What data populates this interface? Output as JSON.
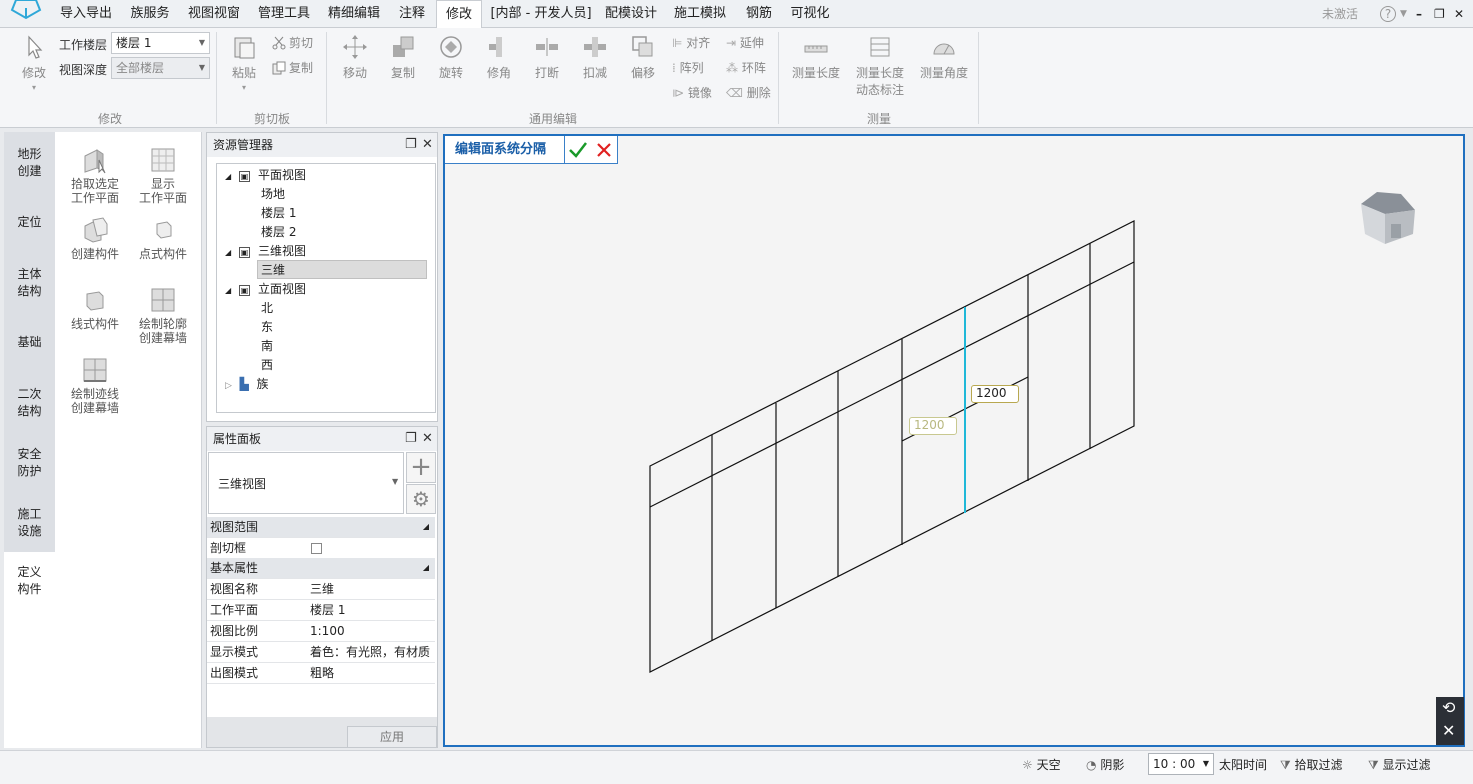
{
  "menu": {
    "items": [
      "导入导出",
      "族服务",
      "视图视窗",
      "管理工具",
      "精细编辑",
      "注释",
      "修改",
      "[内部 - 开发人员]",
      "配模设计",
      "施工模拟",
      "钢筋",
      "可视化"
    ],
    "active": "修改",
    "status_text": "未激活",
    "help": "?"
  },
  "ribbon": {
    "modify": {
      "select_label": "修改",
      "work_floor_label": "工作楼层",
      "work_floor_value": "楼层 1",
      "view_depth_label": "视图深度",
      "view_depth_value": "全部楼层",
      "group": "修改"
    },
    "clipboard": {
      "paste": "粘贴",
      "cut": "剪切",
      "copy": "复制",
      "group": "剪切板"
    },
    "edit": {
      "move": "移动",
      "copy": "复制",
      "rotate": "旋转",
      "trim": "修角",
      "break": "打断",
      "subtract": "扣减",
      "offset": "偏移",
      "align": "对齐",
      "extend": "延伸",
      "array": "阵列",
      "ring_array": "环阵",
      "mirror": "镜像",
      "delete": "删除",
      "group": "通用编辑"
    },
    "measure": {
      "length": "测量长度",
      "dyn_line1": "测量长度",
      "dyn_line2": "动态标注",
      "angle": "测量角度",
      "group": "测量"
    }
  },
  "left_tabs": [
    [
      "地形",
      "创建"
    ],
    [
      "定位",
      ""
    ],
    [
      "主体",
      "结构"
    ],
    [
      "基础",
      ""
    ],
    [
      "二次",
      "结构"
    ],
    [
      "安全",
      "防护"
    ],
    [
      "施工",
      "设施"
    ],
    [
      "定义",
      "构件"
    ]
  ],
  "tools": {
    "pick_plane": [
      "拾取选定",
      "工作平面"
    ],
    "show_plane": [
      "显示",
      "工作平面"
    ],
    "create_part": "创建构件",
    "point_part": "点式构件",
    "line_part": "线式构件",
    "profile_wall": [
      "绘制轮廓",
      "创建幕墙"
    ],
    "trace_wall": [
      "绘制迹线",
      "创建幕墙"
    ]
  },
  "resource_manager": {
    "title": "资源管理器",
    "plan_views": "平面视图",
    "site": "场地",
    "floor1": "楼层 1",
    "floor2": "楼层 2",
    "views_3d": "三维视图",
    "view_3d": "三维",
    "elevations": "立面视图",
    "north": "北",
    "east": "东",
    "south": "南",
    "west": "西",
    "families": "族"
  },
  "properties": {
    "title": "属性面板",
    "type": "三维视图",
    "cat_range": "视图范围",
    "section_box": "剖切框",
    "cat_basic": "基本属性",
    "rows": [
      [
        "视图名称",
        "三维"
      ],
      [
        "工作平面",
        "楼层 1"
      ],
      [
        "视图比例",
        "1:100"
      ],
      [
        "显示模式",
        "着色：有光照，有材质"
      ],
      [
        "出图模式",
        "粗略"
      ]
    ],
    "apply": "应用"
  },
  "viewport": {
    "title": "编辑面系统分隔",
    "dim_a": "1200",
    "dim_b": "1200"
  },
  "status": {
    "sky": "天空",
    "shadow": "阴影",
    "time": "10 : 00",
    "sun_time": "太阳时间",
    "pick_filter": "拾取过滤",
    "show_filter": "显示过滤"
  }
}
